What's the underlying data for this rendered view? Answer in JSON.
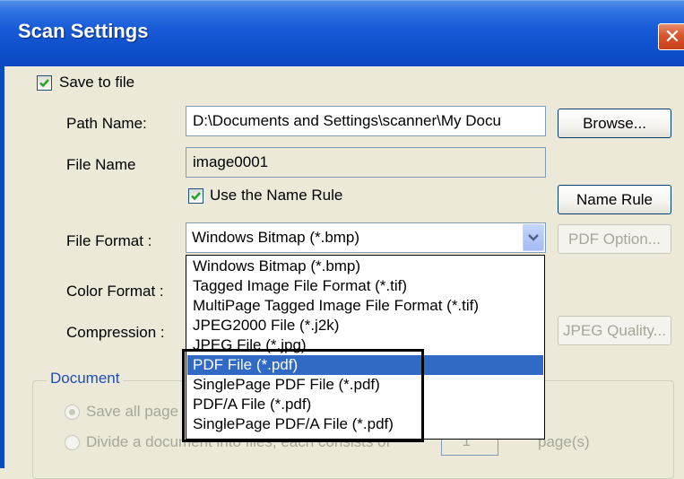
{
  "window": {
    "title": "Scan Settings",
    "close_glyph": "✕"
  },
  "save_to_file": {
    "label": "Save to file",
    "checked": true
  },
  "path": {
    "label": "Path Name:",
    "value": "D:\\Documents and Settings\\scanner\\My Docu",
    "browse_label": "Browse..."
  },
  "file_name": {
    "label": "File Name",
    "value": "image0001"
  },
  "name_rule": {
    "checkbox_label": "Use the Name Rule",
    "checked": true,
    "button_label": "Name Rule"
  },
  "file_format": {
    "label": "File Format :",
    "selected": "Windows Bitmap (*.bmp)",
    "pdf_option_label": "PDF Option...",
    "options": [
      "Windows Bitmap (*.bmp)",
      "Tagged Image File Format (*.tif)",
      "MultiPage Tagged Image File Format (*.tif)",
      "JPEG2000 File (*.j2k)",
      "JPEG File (*.jpg)",
      "PDF File (*.pdf)",
      "SinglePage PDF File (*.pdf)",
      "PDF/A File (*.pdf)",
      "SinglePage PDF/A File (*.pdf)"
    ],
    "highlighted_option": "PDF File (*.pdf)"
  },
  "color_format": {
    "label": "Color Format :"
  },
  "compression": {
    "label": "Compression :",
    "jpeg_quality_label": "JPEG Quality..."
  },
  "document": {
    "group_title": "Document",
    "save_all_label": "Save all page",
    "divide_label": "Divide a document into files, each consists of",
    "pages_value": "1",
    "pages_suffix": "page(s)"
  },
  "colors": {
    "titlebar": "#0c4ac0",
    "selection": "#316ac5",
    "dialog_bg": "#ece9d8",
    "close": "#d6562e"
  },
  "icons": {
    "close": "close-icon",
    "checkmark": "checkmark-icon",
    "dropdown_arrow": "chevron-down-icon"
  }
}
